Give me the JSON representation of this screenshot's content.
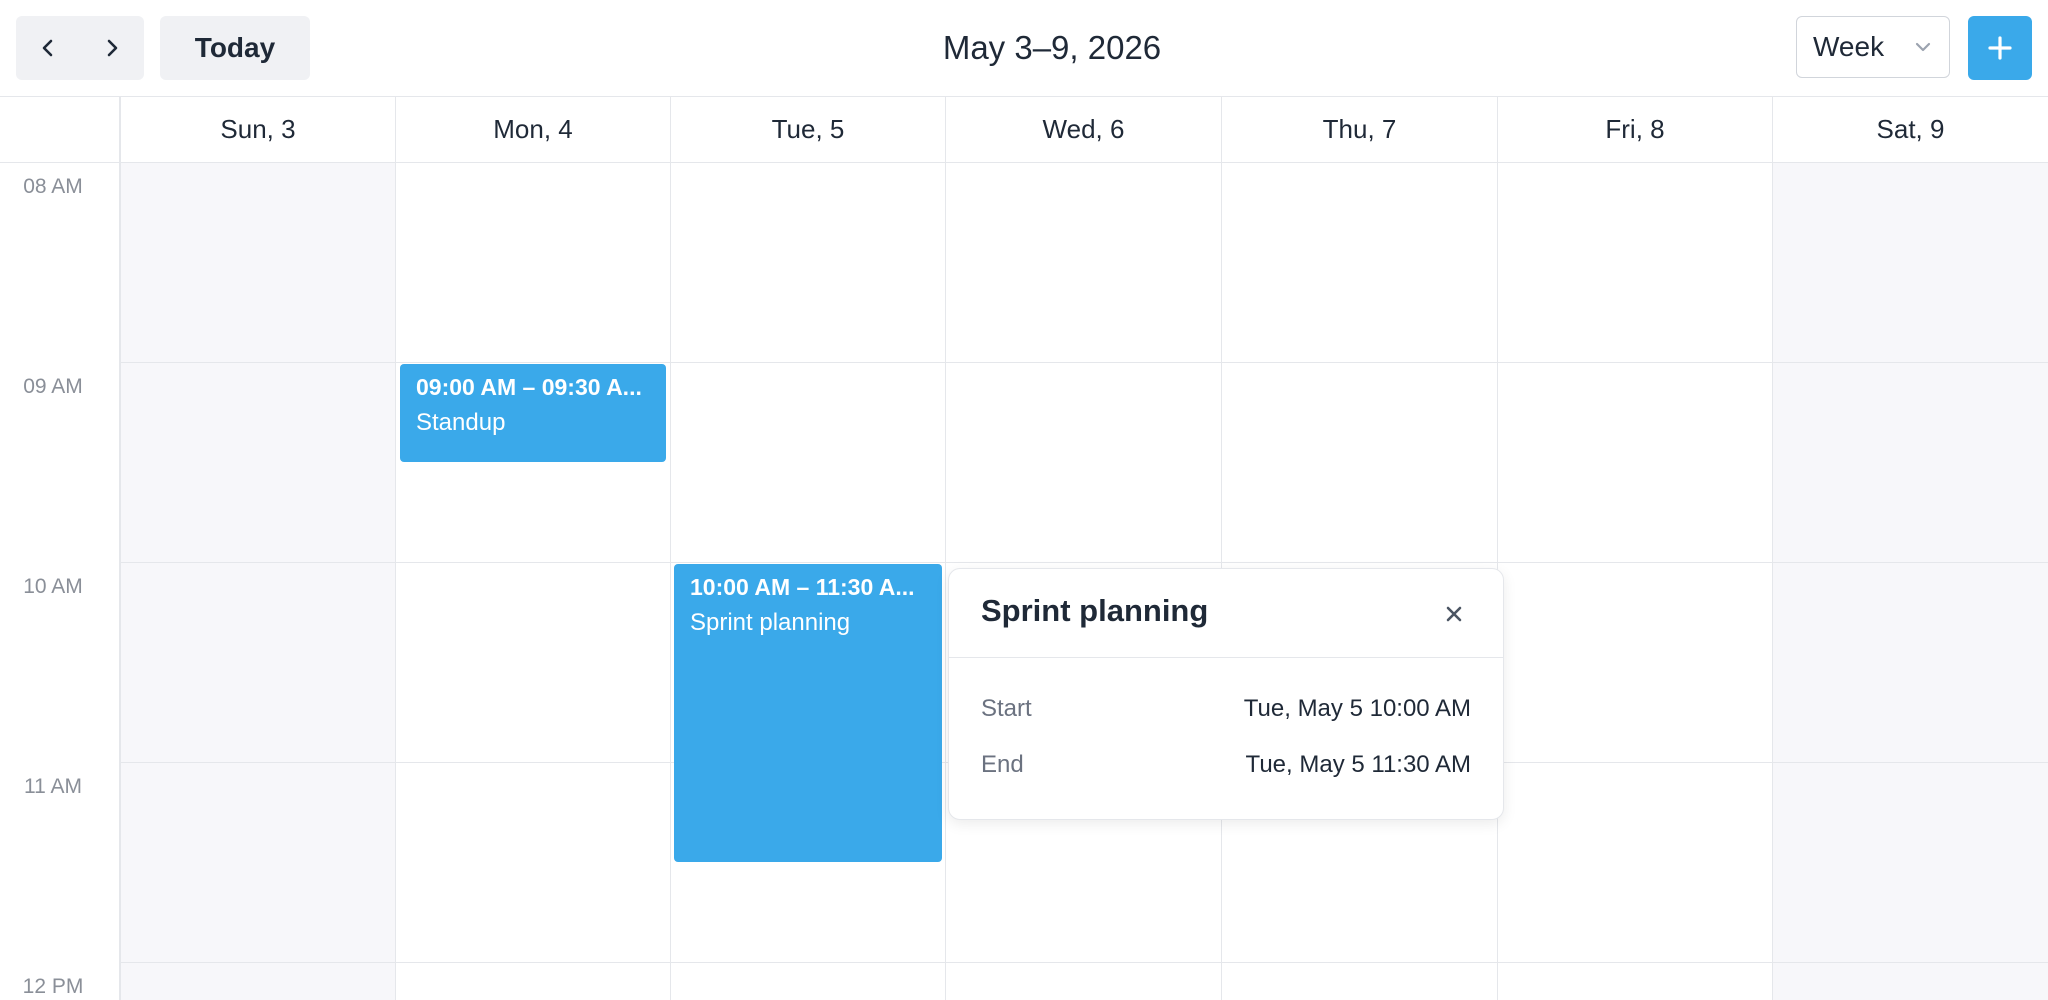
{
  "toolbar": {
    "prev_icon": "chevron-left-icon",
    "next_icon": "chevron-right-icon",
    "today_label": "Today",
    "range_title": "May 3–9, 2026",
    "view_value": "Week",
    "view_icon": "chevron-down-icon",
    "add_icon": "plus-icon"
  },
  "days": [
    {
      "label": "Sun, 3"
    },
    {
      "label": "Mon, 4"
    },
    {
      "label": "Tue, 5"
    },
    {
      "label": "Wed, 6"
    },
    {
      "label": "Thu, 7"
    },
    {
      "label": "Fri, 8"
    },
    {
      "label": "Sat, 9"
    }
  ],
  "time_labels": [
    "08 AM",
    "09 AM",
    "10 AM",
    "11 AM",
    "12 PM"
  ],
  "events": [
    {
      "time": "09:00 AM – 09:30 A...",
      "title": "Standup"
    },
    {
      "time": "10:00 AM – 11:30 A...",
      "title": "Sprint planning"
    }
  ],
  "popover": {
    "title": "Sprint planning",
    "close_icon": "close-icon",
    "start_label": "Start",
    "start_value": "Tue, May 5 10:00 AM",
    "end_label": "End",
    "end_value": "Tue, May 5 11:30 AM"
  },
  "colors": {
    "accent": "#3aa9ea",
    "weekend_bg": "#f7f7fa",
    "grid_line": "#e5e7eb"
  }
}
